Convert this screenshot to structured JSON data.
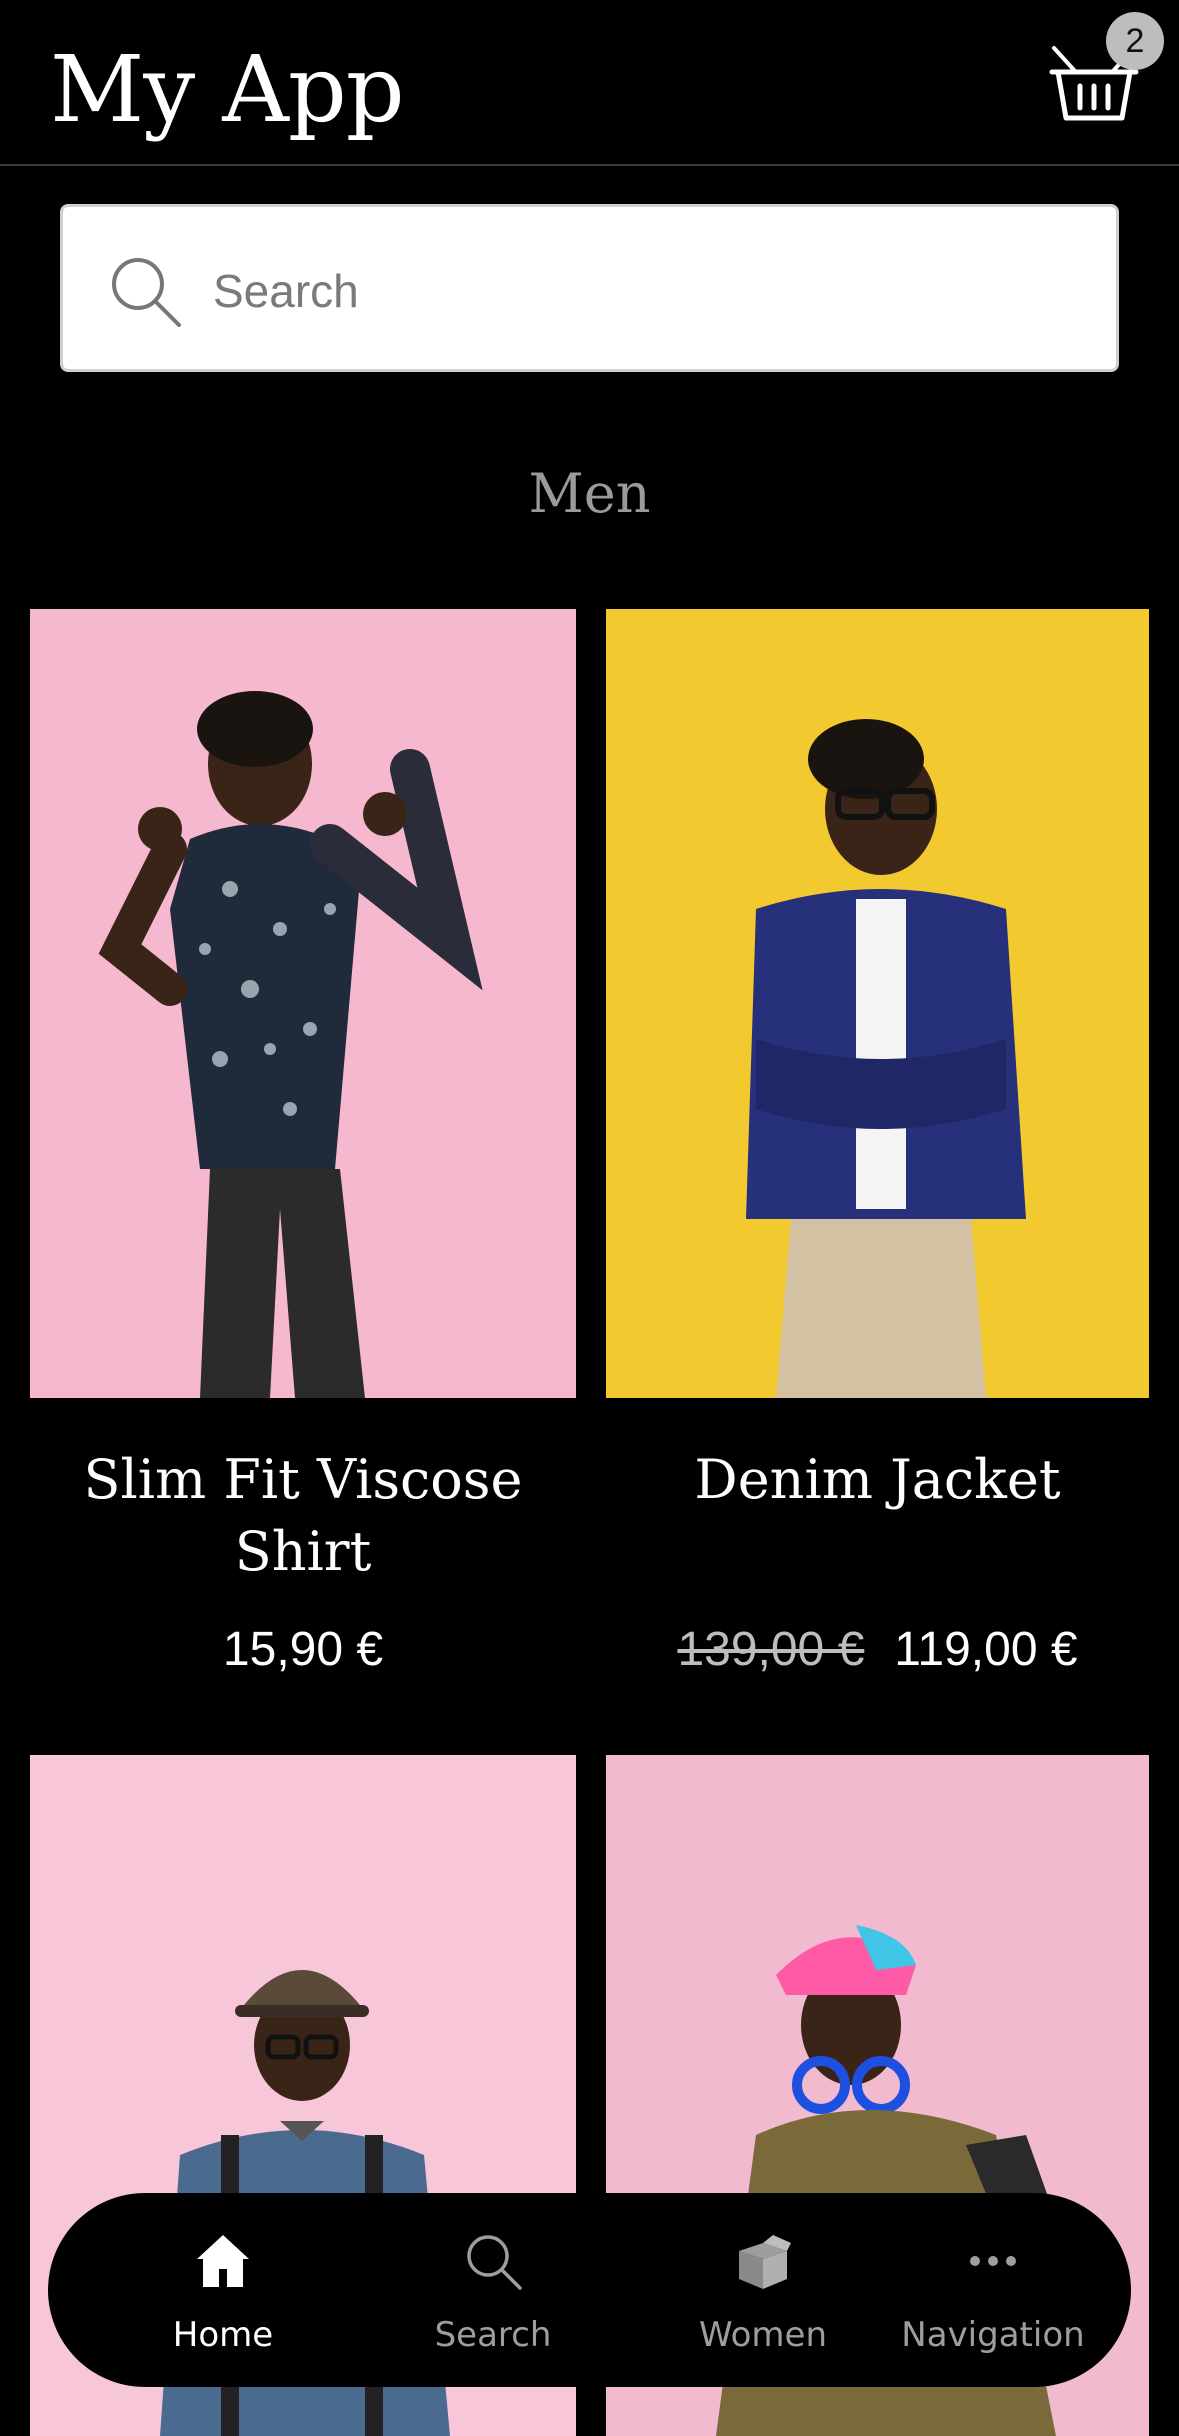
{
  "app": {
    "title": "My App"
  },
  "cart": {
    "count": "2",
    "icon": "basket-icon"
  },
  "search": {
    "placeholder": "Search",
    "icon": "search-icon"
  },
  "section": {
    "title": "Men"
  },
  "products": [
    {
      "name": "Slim Fit Viscose Shirt",
      "price": "15,90 €",
      "old_price": "",
      "bg": "#f6b8cf"
    },
    {
      "name": "Denim Jacket",
      "price": "119,00 €",
      "old_price": "139,00 €",
      "bg": "#f3c930"
    },
    {
      "name": "",
      "price": "",
      "old_price": "",
      "bg": "#f7c6d8"
    },
    {
      "name": "",
      "price": "",
      "old_price": "",
      "bg": "#f2bacf"
    }
  ],
  "bottom_nav": {
    "items": [
      {
        "label": "Home",
        "icon": "home-icon",
        "active": true
      },
      {
        "label": "Search",
        "icon": "search-icon",
        "active": false
      },
      {
        "label": "Women",
        "icon": "box-icon",
        "active": false
      },
      {
        "label": "Navigation",
        "icon": "more-dots-icon",
        "active": false
      }
    ]
  },
  "colors": {
    "background": "#000000",
    "accent": "#ffffff",
    "muted": "#9e9e9e"
  }
}
